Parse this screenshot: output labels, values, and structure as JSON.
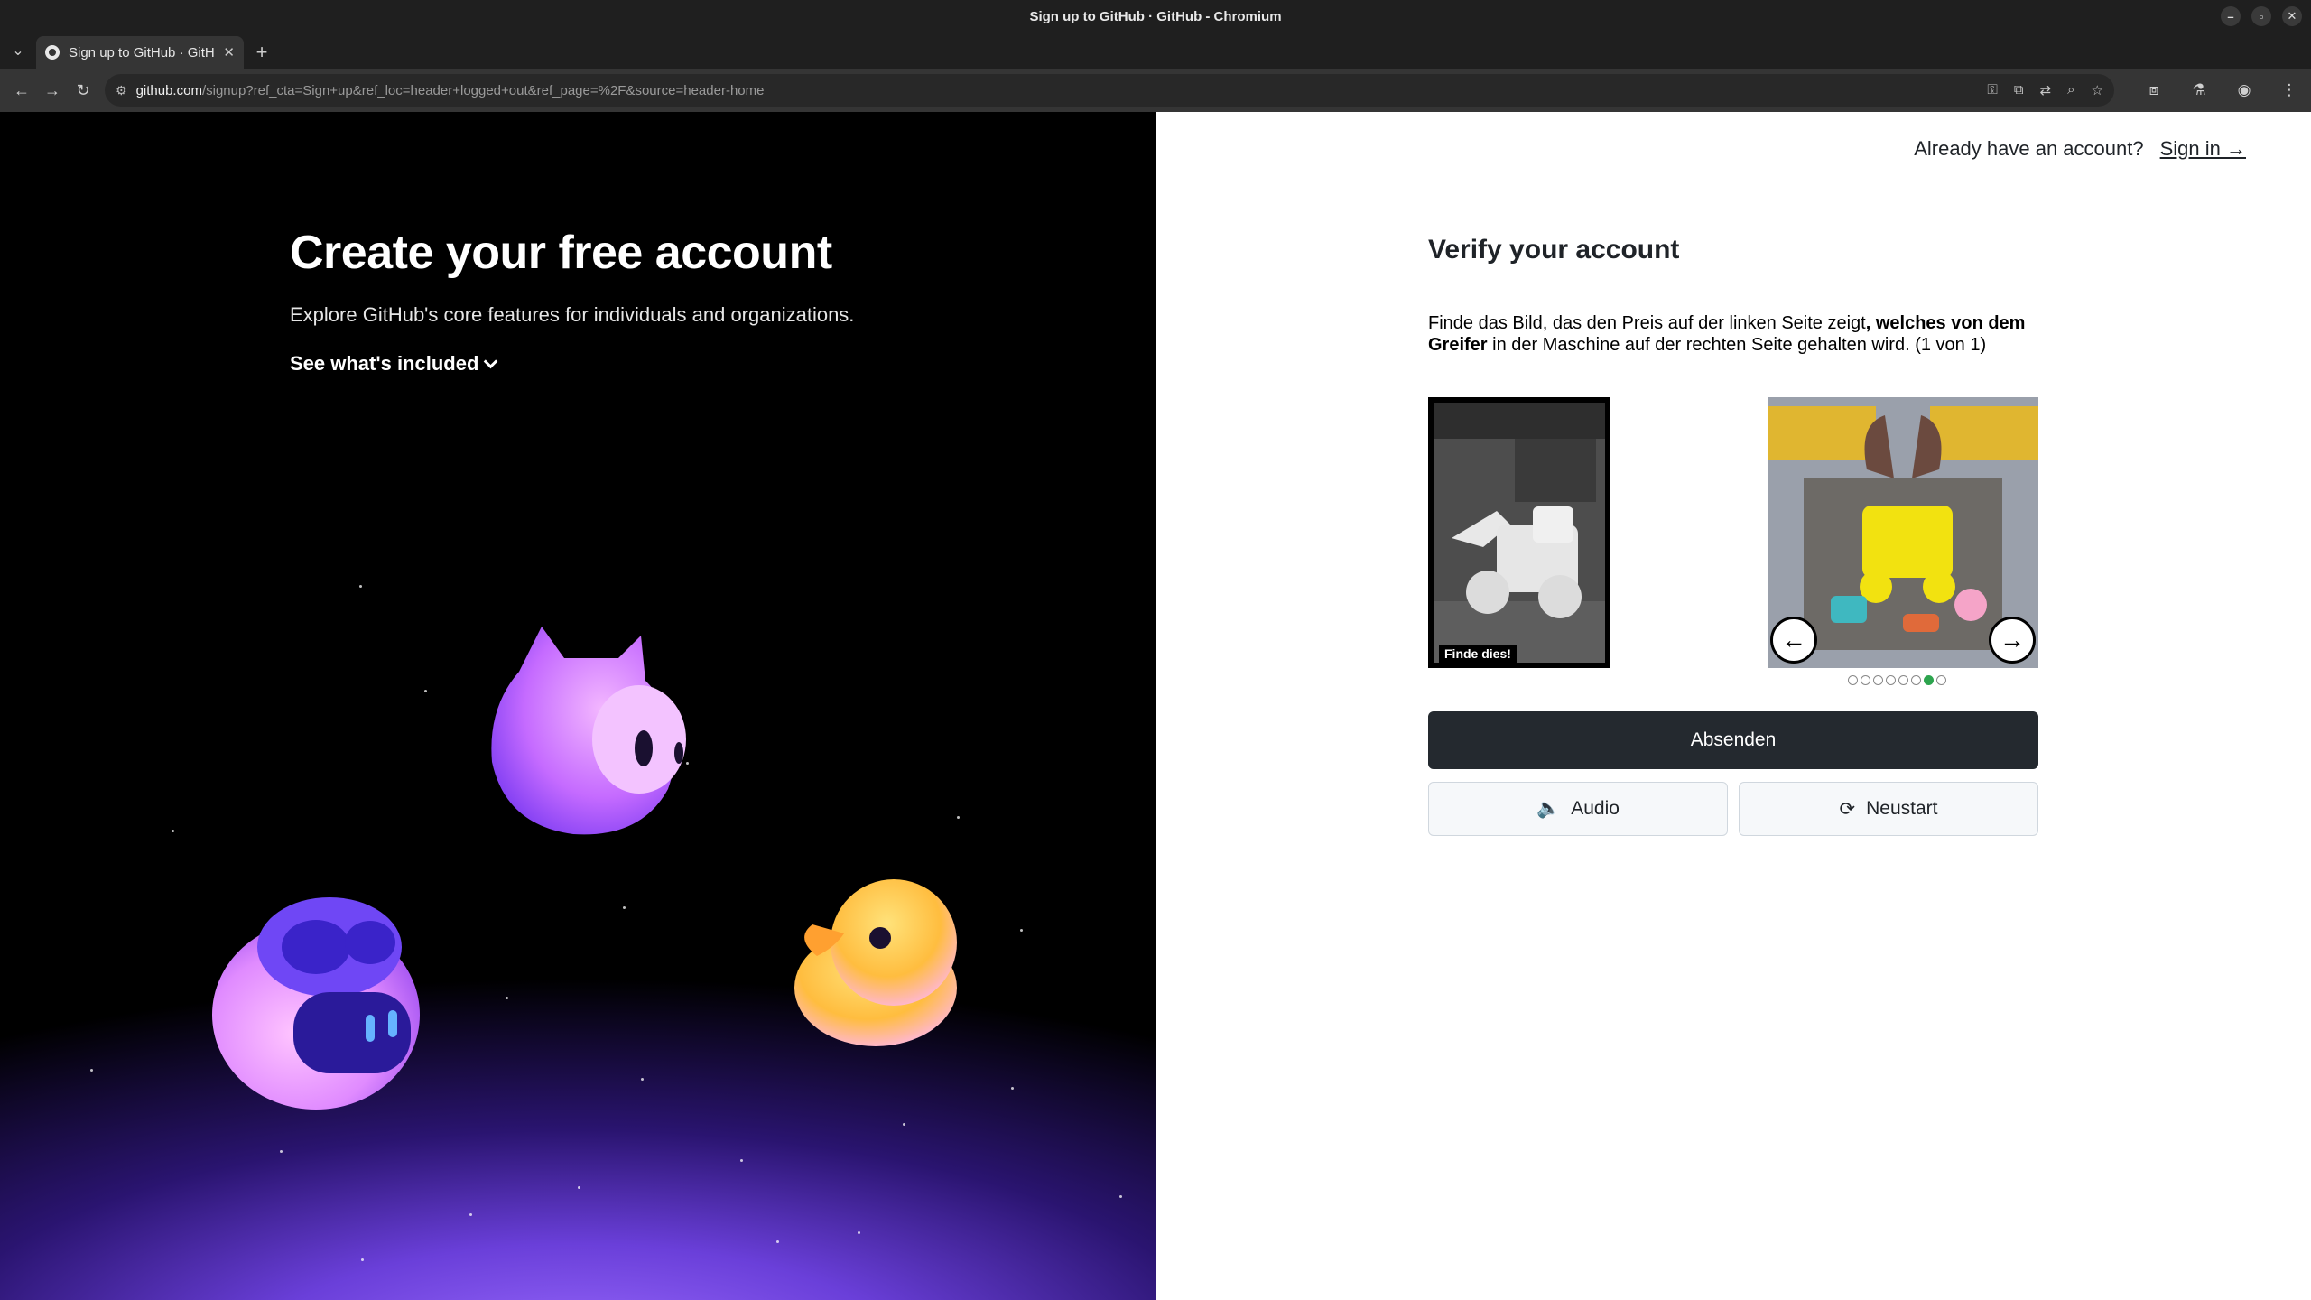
{
  "browser": {
    "window_title": "Sign up to GitHub · GitHub - Chromium",
    "controls": {
      "minimize": "–",
      "maximize": "▫",
      "close": "✕"
    },
    "tab": {
      "title": "Sign up to GitHub · GitHub",
      "close": "✕"
    },
    "new_tab": "+",
    "url_host": "github.com",
    "url_path": "/signup?ref_cta=Sign+up&ref_loc=header+logged+out&ref_page=%2F&source=header-home"
  },
  "left": {
    "title": "Create your free account",
    "subtitle": "Explore GitHub's core features for individuals and organizations.",
    "see_included": "See what's included"
  },
  "right": {
    "already_text": "Already have an account?",
    "sign_in": "Sign in →",
    "verify_title": "Verify your account",
    "instruction_part1": "Finde das Bild, das den Preis auf der linken Seite zeigt",
    "instruction_bold": ", welches von dem Greifer",
    "instruction_part2": " in der Maschine auf der rechten Seite gehalten wird. (1 von 1)",
    "reference_label": "Finde dies!",
    "carousel": {
      "total": 8,
      "active_index": 6
    },
    "submit": "Absenden",
    "audio": "Audio",
    "restart": "Neustart"
  },
  "colors": {
    "accent_dark": "#24292f",
    "active_dot": "#2da44e"
  }
}
